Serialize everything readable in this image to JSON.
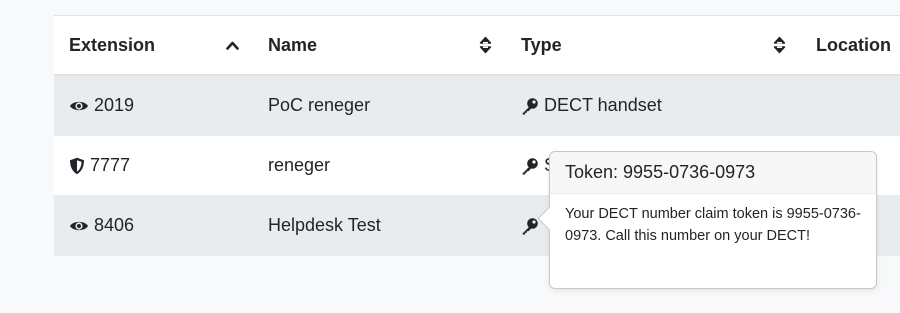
{
  "table": {
    "headers": {
      "extension": "Extension",
      "name": "Name",
      "type": "Type",
      "location": "Location"
    },
    "rows": [
      {
        "extension": "2019",
        "extension_icon": "eye-icon",
        "name": "PoC reneger",
        "type": "DECT handset",
        "type_icon": "key-icon"
      },
      {
        "extension": "7777",
        "extension_icon": "shield-icon",
        "name": "reneger",
        "type": "S",
        "type_icon": "key-icon"
      },
      {
        "extension": "8406",
        "extension_icon": "eye-icon",
        "name": "Helpdesk Test",
        "type": "",
        "type_icon": "key-icon"
      }
    ]
  },
  "popover": {
    "title": "Token: 9955-0736-0973",
    "body": "Your DECT number claim token is 9955-0736-0973. Call this number on your DECT!"
  }
}
